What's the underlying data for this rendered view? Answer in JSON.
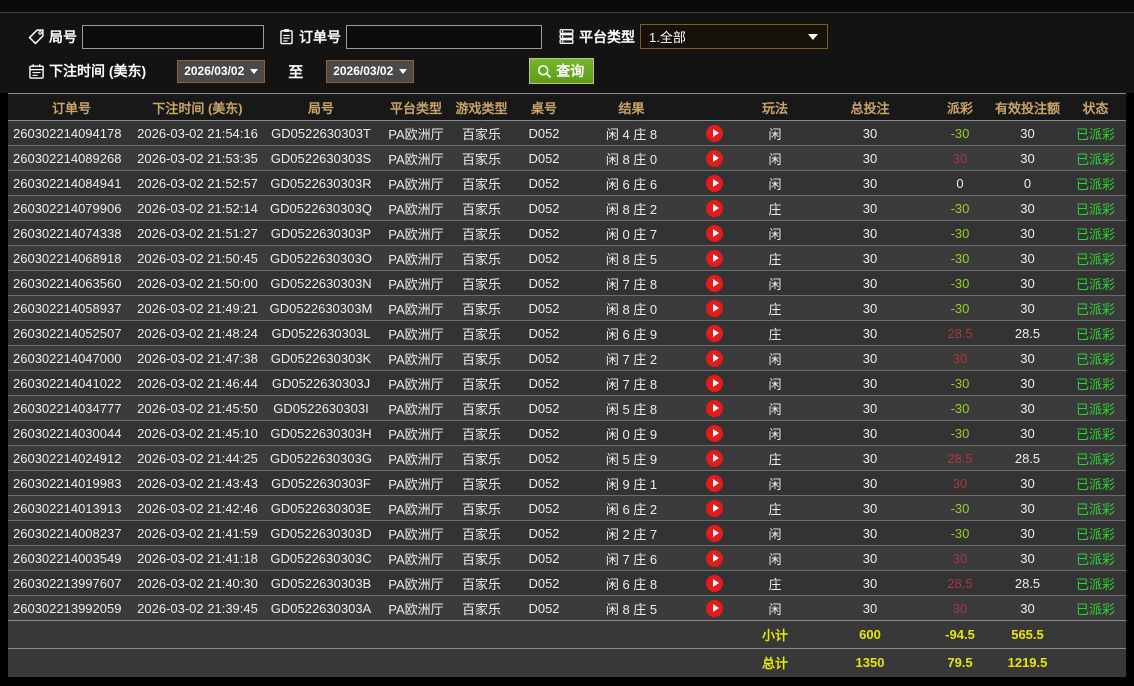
{
  "filters": {
    "round_label": "局号",
    "round_value": "",
    "order_label": "订单号",
    "order_value": "",
    "platform_label": "平台类型",
    "platform_value": "1.全部",
    "bet_time_label": "下注时间 (美东)",
    "date_from": "2026/03/02",
    "to_label": "至",
    "date_to": "2026/03/02",
    "query_label": "查询"
  },
  "colors": {
    "header_text": "#c8a468",
    "payout_negative": "#97cd2d",
    "payout_positive": "#a83a3e",
    "status_paid": "#2dd335",
    "totals_text": "#e6e60a",
    "query_button": "#67ab22",
    "play_icon": "#e31b1b"
  },
  "table": {
    "columns": [
      "订单号",
      "下注时间 (美东)",
      "局号",
      "平台类型",
      "游戏类型",
      "桌号",
      "结果",
      "",
      "玩法",
      "总投注",
      "派彩",
      "有效投注额",
      "状态"
    ],
    "rows": [
      {
        "order": "260302214094178",
        "time": "2026-03-02 21:54:16",
        "round": "GD0522630303T",
        "platform": "PA欧洲厅",
        "game": "百家乐",
        "table_no": "D052",
        "result": "闲 4 庄 8",
        "bet_type": "闲",
        "total_bet": "30",
        "payout": "-30",
        "valid_bet": "30",
        "status": "已派彩"
      },
      {
        "order": "260302214089268",
        "time": "2026-03-02 21:53:35",
        "round": "GD0522630303S",
        "platform": "PA欧洲厅",
        "game": "百家乐",
        "table_no": "D052",
        "result": "闲 8 庄 0",
        "bet_type": "闲",
        "total_bet": "30",
        "payout": "30",
        "valid_bet": "30",
        "status": "已派彩"
      },
      {
        "order": "260302214084941",
        "time": "2026-03-02 21:52:57",
        "round": "GD0522630303R",
        "platform": "PA欧洲厅",
        "game": "百家乐",
        "table_no": "D052",
        "result": "闲 6 庄 6",
        "bet_type": "闲",
        "total_bet": "30",
        "payout": "0",
        "valid_bet": "0",
        "status": "已派彩"
      },
      {
        "order": "260302214079906",
        "time": "2026-03-02 21:52:14",
        "round": "GD0522630303Q",
        "platform": "PA欧洲厅",
        "game": "百家乐",
        "table_no": "D052",
        "result": "闲 8 庄 2",
        "bet_type": "庄",
        "total_bet": "30",
        "payout": "-30",
        "valid_bet": "30",
        "status": "已派彩"
      },
      {
        "order": "260302214074338",
        "time": "2026-03-02 21:51:27",
        "round": "GD0522630303P",
        "platform": "PA欧洲厅",
        "game": "百家乐",
        "table_no": "D052",
        "result": "闲 0 庄 7",
        "bet_type": "闲",
        "total_bet": "30",
        "payout": "-30",
        "valid_bet": "30",
        "status": "已派彩"
      },
      {
        "order": "260302214068918",
        "time": "2026-03-02 21:50:45",
        "round": "GD0522630303O",
        "platform": "PA欧洲厅",
        "game": "百家乐",
        "table_no": "D052",
        "result": "闲 8 庄 5",
        "bet_type": "庄",
        "total_bet": "30",
        "payout": "-30",
        "valid_bet": "30",
        "status": "已派彩"
      },
      {
        "order": "260302214063560",
        "time": "2026-03-02 21:50:00",
        "round": "GD0522630303N",
        "platform": "PA欧洲厅",
        "game": "百家乐",
        "table_no": "D052",
        "result": "闲 7 庄 8",
        "bet_type": "闲",
        "total_bet": "30",
        "payout": "-30",
        "valid_bet": "30",
        "status": "已派彩"
      },
      {
        "order": "260302214058937",
        "time": "2026-03-02 21:49:21",
        "round": "GD0522630303M",
        "platform": "PA欧洲厅",
        "game": "百家乐",
        "table_no": "D052",
        "result": "闲 8 庄 0",
        "bet_type": "庄",
        "total_bet": "30",
        "payout": "-30",
        "valid_bet": "30",
        "status": "已派彩"
      },
      {
        "order": "260302214052507",
        "time": "2026-03-02 21:48:24",
        "round": "GD0522630303L",
        "platform": "PA欧洲厅",
        "game": "百家乐",
        "table_no": "D052",
        "result": "闲 6 庄 9",
        "bet_type": "庄",
        "total_bet": "30",
        "payout": "28.5",
        "valid_bet": "28.5",
        "status": "已派彩"
      },
      {
        "order": "260302214047000",
        "time": "2026-03-02 21:47:38",
        "round": "GD0522630303K",
        "platform": "PA欧洲厅",
        "game": "百家乐",
        "table_no": "D052",
        "result": "闲 7 庄 2",
        "bet_type": "闲",
        "total_bet": "30",
        "payout": "30",
        "valid_bet": "30",
        "status": "已派彩"
      },
      {
        "order": "260302214041022",
        "time": "2026-03-02 21:46:44",
        "round": "GD0522630303J",
        "platform": "PA欧洲厅",
        "game": "百家乐",
        "table_no": "D052",
        "result": "闲 7 庄 8",
        "bet_type": "闲",
        "total_bet": "30",
        "payout": "-30",
        "valid_bet": "30",
        "status": "已派彩"
      },
      {
        "order": "260302214034777",
        "time": "2026-03-02 21:45:50",
        "round": "GD0522630303I",
        "platform": "PA欧洲厅",
        "game": "百家乐",
        "table_no": "D052",
        "result": "闲 5 庄 8",
        "bet_type": "闲",
        "total_bet": "30",
        "payout": "-30",
        "valid_bet": "30",
        "status": "已派彩"
      },
      {
        "order": "260302214030044",
        "time": "2026-03-02 21:45:10",
        "round": "GD0522630303H",
        "platform": "PA欧洲厅",
        "game": "百家乐",
        "table_no": "D052",
        "result": "闲 0 庄 9",
        "bet_type": "闲",
        "total_bet": "30",
        "payout": "-30",
        "valid_bet": "30",
        "status": "已派彩"
      },
      {
        "order": "260302214024912",
        "time": "2026-03-02 21:44:25",
        "round": "GD0522630303G",
        "platform": "PA欧洲厅",
        "game": "百家乐",
        "table_no": "D052",
        "result": "闲 5 庄 9",
        "bet_type": "庄",
        "total_bet": "30",
        "payout": "28.5",
        "valid_bet": "28.5",
        "status": "已派彩"
      },
      {
        "order": "260302214019983",
        "time": "2026-03-02 21:43:43",
        "round": "GD0522630303F",
        "platform": "PA欧洲厅",
        "game": "百家乐",
        "table_no": "D052",
        "result": "闲 9 庄 1",
        "bet_type": "闲",
        "total_bet": "30",
        "payout": "30",
        "valid_bet": "30",
        "status": "已派彩"
      },
      {
        "order": "260302214013913",
        "time": "2026-03-02 21:42:46",
        "round": "GD0522630303E",
        "platform": "PA欧洲厅",
        "game": "百家乐",
        "table_no": "D052",
        "result": "闲 6 庄 2",
        "bet_type": "庄",
        "total_bet": "30",
        "payout": "-30",
        "valid_bet": "30",
        "status": "已派彩"
      },
      {
        "order": "260302214008237",
        "time": "2026-03-02 21:41:59",
        "round": "GD0522630303D",
        "platform": "PA欧洲厅",
        "game": "百家乐",
        "table_no": "D052",
        "result": "闲 2 庄 7",
        "bet_type": "闲",
        "total_bet": "30",
        "payout": "-30",
        "valid_bet": "30",
        "status": "已派彩"
      },
      {
        "order": "260302214003549",
        "time": "2026-03-02 21:41:18",
        "round": "GD0522630303C",
        "platform": "PA欧洲厅",
        "game": "百家乐",
        "table_no": "D052",
        "result": "闲 7 庄 6",
        "bet_type": "闲",
        "total_bet": "30",
        "payout": "30",
        "valid_bet": "30",
        "status": "已派彩"
      },
      {
        "order": "260302213997607",
        "time": "2026-03-02 21:40:30",
        "round": "GD0522630303B",
        "platform": "PA欧洲厅",
        "game": "百家乐",
        "table_no": "D052",
        "result": "闲 6 庄 8",
        "bet_type": "庄",
        "total_bet": "30",
        "payout": "28.5",
        "valid_bet": "28.5",
        "status": "已派彩"
      },
      {
        "order": "260302213992059",
        "time": "2026-03-02 21:39:45",
        "round": "GD0522630303A",
        "platform": "PA欧洲厅",
        "game": "百家乐",
        "table_no": "D052",
        "result": "闲 8 庄 5",
        "bet_type": "闲",
        "total_bet": "30",
        "payout": "30",
        "valid_bet": "30",
        "status": "已派彩"
      }
    ],
    "totals": [
      {
        "label": "小计",
        "total_bet": "600",
        "payout": "-94.5",
        "valid_bet": "565.5"
      },
      {
        "label": "总计",
        "total_bet": "1350",
        "payout": "79.5",
        "valid_bet": "1219.5"
      }
    ]
  }
}
